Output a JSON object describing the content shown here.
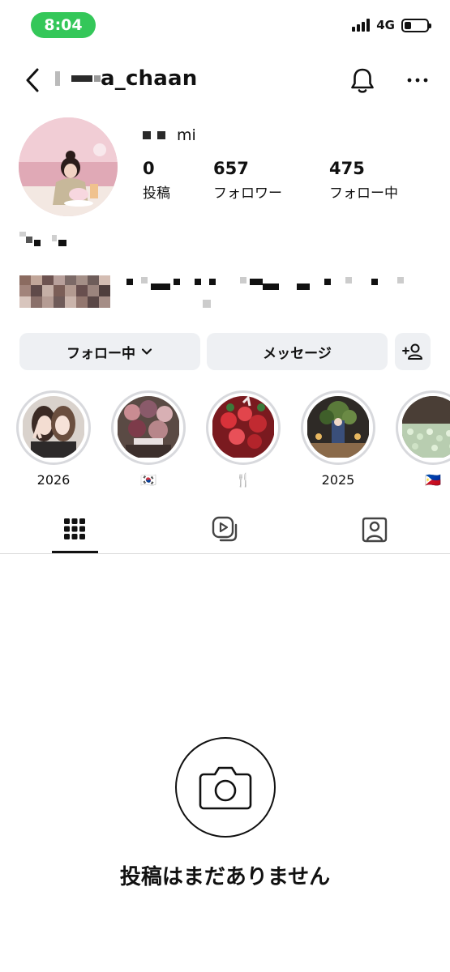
{
  "status_bar": {
    "time": "8:04",
    "network": "4G",
    "time_pill_color": "#34c759",
    "battery_level": 0.3
  },
  "header": {
    "username": "a_chaan",
    "icons": [
      "back-icon",
      "bell-icon",
      "more-icon"
    ]
  },
  "profile": {
    "display_name": "mi",
    "stats": [
      {
        "num": "0",
        "label": "投稿"
      },
      {
        "num": "657",
        "label": "フォロワー"
      },
      {
        "num": "475",
        "label": "フォロー中"
      }
    ]
  },
  "actions": {
    "following": "フォロー中",
    "message": "メッセージ"
  },
  "highlights": [
    {
      "label": "2026"
    },
    {
      "label": "🇰🇷"
    },
    {
      "label": "🍴"
    },
    {
      "label": "2025"
    },
    {
      "label": "🇵🇭"
    }
  ],
  "tabs": [
    "grid-icon",
    "reels-icon",
    "tagged-icon"
  ],
  "empty": {
    "message": "投稿はまだありません"
  }
}
